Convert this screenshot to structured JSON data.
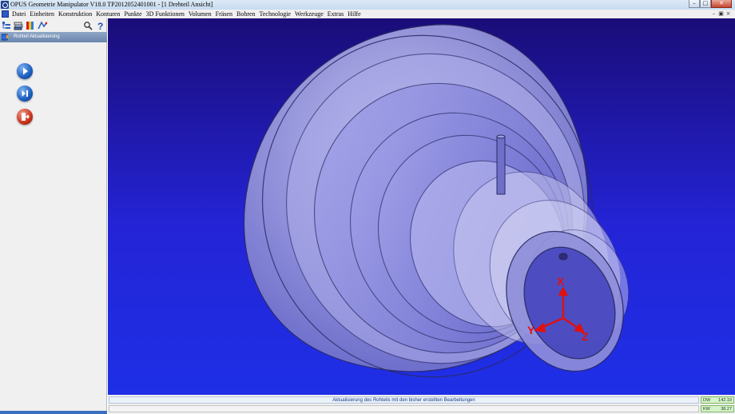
{
  "window": {
    "title": "OPUS Geometrie Manipulator V18.0   TP2012052401001   - [1 Drehteil Ansicht]",
    "controls": [
      "minimize-icon",
      "maximize-icon",
      "close-icon"
    ]
  },
  "menu": {
    "items": [
      "Datei",
      "Einheiten",
      "Konstruktion",
      "Konturen",
      "Punkte",
      "3D Funktionen",
      "Volumen",
      "Fräsen",
      "Bohren",
      "Technologie",
      "Werkzeuge",
      "Extras",
      "Hilfe"
    ]
  },
  "toolbar": {
    "icons": [
      "tree-view-icon",
      "layers-icon",
      "color-palette-icon",
      "toolpath-icon",
      "search-tool-icon",
      "help-icon"
    ]
  },
  "panel": {
    "title": "Rohteil Aktualisierung",
    "buttons": [
      "play-icon",
      "step-icon",
      "exit-icon"
    ]
  },
  "viewport": {
    "axis_labels": {
      "x": "X",
      "y": "Y",
      "z": "Z"
    },
    "colors": {
      "background_top": "#1a0c78",
      "background_bottom": "#1e2fe6",
      "axes": "#e01010",
      "part": "#b8b8ef"
    }
  },
  "status": {
    "message": "Aktualisierung des Rohteils mit den bisher erstellten Bearbeitungen",
    "readouts": [
      {
        "label": "DW",
        "value": "142.19"
      },
      {
        "label": "KW",
        "value": "38.27"
      }
    ]
  }
}
